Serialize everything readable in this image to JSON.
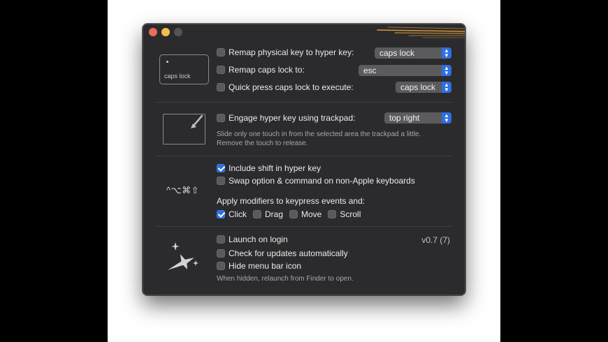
{
  "section_caps": {
    "keycap_label": "caps lock",
    "remap_physical_label": "Remap physical key to hyper key:",
    "remap_physical_value": "caps lock",
    "remap_caps_label": "Remap caps lock to:",
    "remap_caps_value": "esc",
    "quick_press_label": "Quick press caps lock to execute:",
    "quick_press_value": "caps lock"
  },
  "section_trackpad": {
    "engage_label": "Engage hyper key using trackpad:",
    "engage_value": "top right",
    "hint_line1": "Slide only one touch in from the selected area the trackpad a little.",
    "hint_line2": "Remove the touch to release."
  },
  "section_modifiers": {
    "modifier_symbols": "^⌥⌘⇧",
    "include_shift_label": "Include shift in hyper key",
    "include_shift_checked": true,
    "swap_label": "Swap option & command on non-Apple keyboards",
    "swap_checked": false,
    "apply_label": "Apply modifiers to keypress events and:",
    "click_label": "Click",
    "drag_label": "Drag",
    "move_label": "Move",
    "scroll_label": "Scroll"
  },
  "section_app": {
    "launch_label": "Launch on login",
    "version": "v0.7 (7)",
    "updates_label": "Check for updates automatically",
    "hide_label": "Hide menu bar icon",
    "hint": "When hidden, relaunch from Finder to open."
  },
  "colors": {
    "accent": "#2e6fe0",
    "window_bg": "#2b2b2d",
    "streak": "#e8a33a"
  }
}
